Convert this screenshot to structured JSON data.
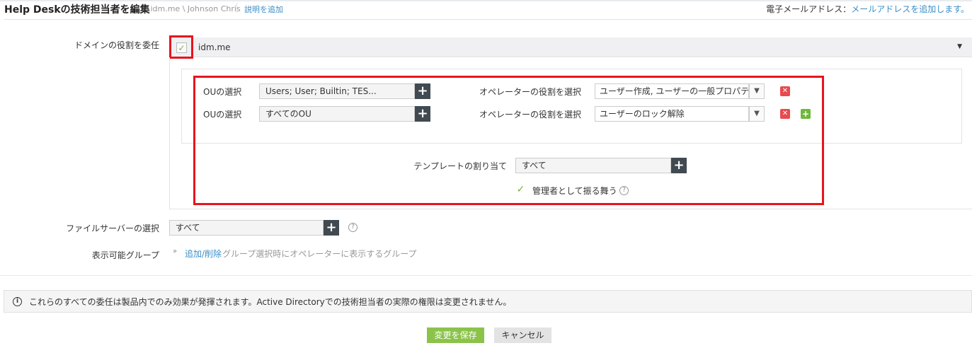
{
  "header": {
    "title": "Help Deskの技術担当者を編集",
    "breadcrumb": "- idm.me \\ Johnson Chris",
    "add_description": "説明を追加",
    "email_label": "電子メールアドレス：",
    "email_link": "メールアドレスを追加します。"
  },
  "domain": {
    "label": "ドメインの役割を委任",
    "name": "idm.me",
    "checked": true
  },
  "rows": [
    {
      "ou_label": "OUの選択",
      "ou_value": "Users; User; Builtin; TES...",
      "role_label": "オペレーターの役割を選択",
      "role_value": "ユーザー作成, ユーザーの一般プロパティ"
    },
    {
      "ou_label": "OUの選択",
      "ou_value": "すべてのOU",
      "role_label": "オペレーターの役割を選択",
      "role_value": "ユーザーのロック解除"
    }
  ],
  "template": {
    "label": "テンプレートの割り当て",
    "value": "すべて"
  },
  "act_as_admin": {
    "label": "管理者として振る舞う",
    "checked": true
  },
  "file_server": {
    "label": "ファイルサーバーの選択",
    "value": "すべて"
  },
  "visible_groups": {
    "label": "表示可能グループ",
    "link": "追加/削除",
    "hint": "グループ選択時にオペレーターに表示するグループ"
  },
  "info": "これらのすべての委任は製品内でのみ効果が発揮されます。Active Directoryでの技術担当者の実際の権限は変更されません。",
  "buttons": {
    "save": "変更を保存",
    "cancel": "キャンセル"
  },
  "colors": {
    "highlight": "#e8141c",
    "save": "#8bc34a",
    "link": "#3a8ec7"
  }
}
